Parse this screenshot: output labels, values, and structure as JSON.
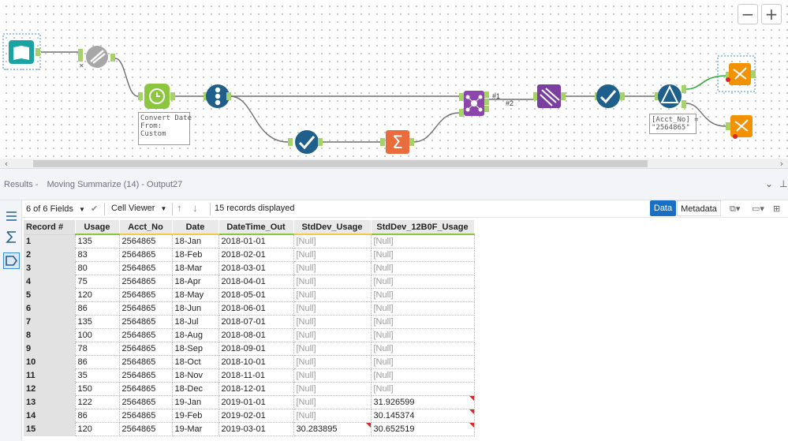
{
  "canvas": {
    "zoom_out_label": "−",
    "zoom_in_label": "+",
    "formula_label": "Convert Date\nFrom:\nCustom",
    "filter_label": "[Acct_No] =\n\"2564865\"",
    "join_anchor_1": "#1",
    "join_anchor_2": "#2",
    "colors": {
      "input": "#1aa3a3",
      "datetime": "#8cc63f",
      "recordid": "#1f5f8b",
      "join": "#8e44ad",
      "summarize": "#e96c3c",
      "output": "#f39200"
    }
  },
  "results": {
    "section": "Results",
    "separator": "-",
    "context": "Moving Summarize (14) - Output27",
    "icons": [
      "chevron-down-icon",
      "pin-icon"
    ]
  },
  "toolbar": {
    "fields": "6 of 6 Fields",
    "cell_viewer": "Cell Viewer",
    "records": "15 records displayed",
    "data_btn": "Data",
    "metadata_btn": "Metadata"
  },
  "grid": {
    "headers": [
      "Record #",
      "Usage",
      "Acct_No",
      "Date",
      "DateTime_Out",
      "StdDev_Usage",
      "StdDev_12B0F_Usage"
    ],
    "rows": [
      [
        "1",
        "135",
        "2564865",
        "18-Jan",
        "2018-01-01",
        "[Null]",
        "[Null]"
      ],
      [
        "2",
        "83",
        "2564865",
        "18-Feb",
        "2018-02-01",
        "[Null]",
        "[Null]"
      ],
      [
        "3",
        "80",
        "2564865",
        "18-Mar",
        "2018-03-01",
        "[Null]",
        "[Null]"
      ],
      [
        "4",
        "75",
        "2564865",
        "18-Apr",
        "2018-04-01",
        "[Null]",
        "[Null]"
      ],
      [
        "5",
        "120",
        "2564865",
        "18-May",
        "2018-05-01",
        "[Null]",
        "[Null]"
      ],
      [
        "6",
        "86",
        "2564865",
        "18-Jun",
        "2018-06-01",
        "[Null]",
        "[Null]"
      ],
      [
        "7",
        "135",
        "2564865",
        "18-Jul",
        "2018-07-01",
        "[Null]",
        "[Null]"
      ],
      [
        "8",
        "100",
        "2564865",
        "18-Aug",
        "2018-08-01",
        "[Null]",
        "[Null]"
      ],
      [
        "9",
        "78",
        "2564865",
        "18-Sep",
        "2018-09-01",
        "[Null]",
        "[Null]"
      ],
      [
        "10",
        "86",
        "2564865",
        "18-Oct",
        "2018-10-01",
        "[Null]",
        "[Null]"
      ],
      [
        "11",
        "35",
        "2564865",
        "18-Nov",
        "2018-11-01",
        "[Null]",
        "[Null]"
      ],
      [
        "12",
        "150",
        "2564865",
        "18-Dec",
        "2018-12-01",
        "[Null]",
        "[Null]"
      ],
      [
        "13",
        "122",
        "2564865",
        "19-Jan",
        "2019-01-01",
        "[Null]",
        "31.926599"
      ],
      [
        "14",
        "86",
        "2564865",
        "19-Feb",
        "2019-02-01",
        "[Null]",
        "30.145374"
      ],
      [
        "15",
        "120",
        "2564865",
        "19-Mar",
        "2019-03-01",
        "30.283895",
        "30.652519"
      ]
    ]
  }
}
